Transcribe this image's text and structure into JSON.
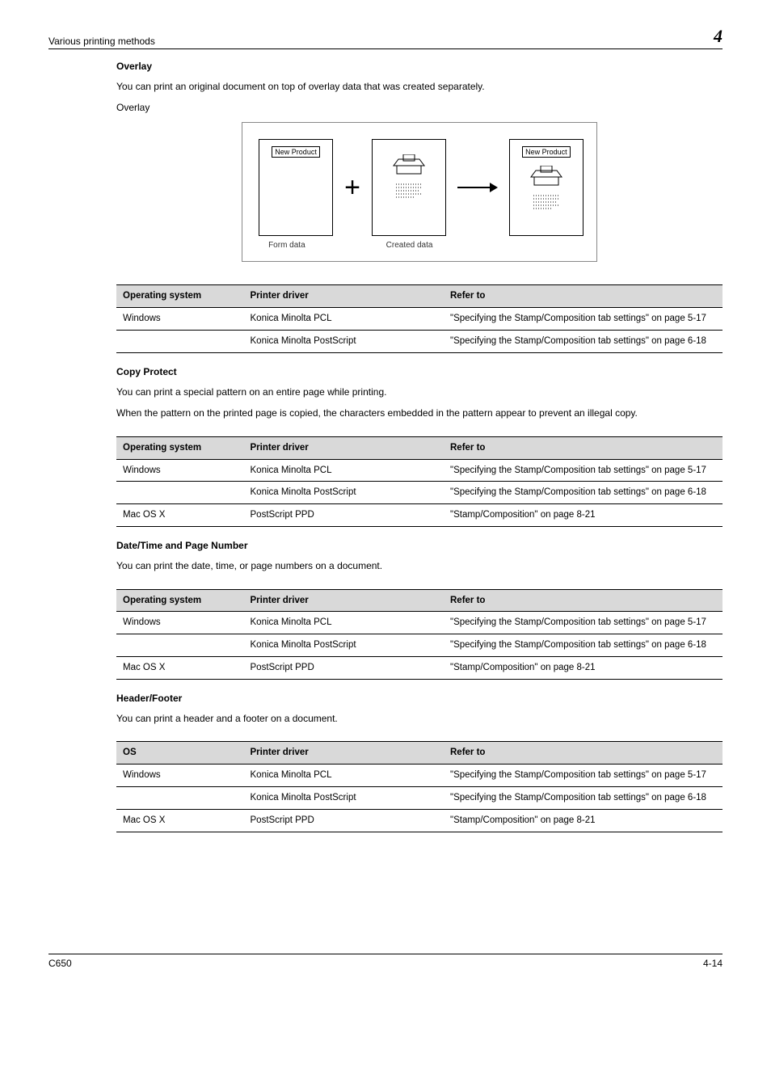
{
  "header": {
    "left": "Various printing methods",
    "right": "4"
  },
  "diagram": {
    "box1_label": "New Product",
    "box3_label": "New Product",
    "caption1": "Form data",
    "caption2": "Created data"
  },
  "sections": {
    "overlay": {
      "title": "Overlay",
      "desc": "You can print an original document on top of overlay data that was created separately.",
      "sub": "Overlay"
    },
    "copy_protect": {
      "title": "Copy Protect",
      "p1": "You can print a special pattern on an entire page while printing.",
      "p2": "When the pattern on the printed page is copied, the characters embedded in the pattern appear to prevent an illegal copy."
    },
    "date_time": {
      "title": "Date/Time and Page Number",
      "desc": "You can print the date, time, or page numbers on a document."
    },
    "header_footer": {
      "title": "Header/Footer",
      "desc": "You can print a header and a footer on a document."
    }
  },
  "table_headers": {
    "os": "Operating system",
    "os_alt": "OS",
    "drv": "Printer driver",
    "ref": "Refer to"
  },
  "tables": {
    "overlay": [
      {
        "os": "Windows",
        "drv": "Konica Minolta PCL",
        "ref": "\"Specifying the Stamp/Composition tab settings\" on page 5-17"
      },
      {
        "os": "",
        "drv": "Konica Minolta PostScript",
        "ref": "\"Specifying the Stamp/Composition tab settings\" on page 6-18"
      }
    ],
    "copy_protect": [
      {
        "os": "Windows",
        "drv": "Konica Minolta PCL",
        "ref": "\"Specifying the Stamp/Composition tab settings\" on page 5-17"
      },
      {
        "os": "",
        "drv": "Konica Minolta PostScript",
        "ref": "\"Specifying the Stamp/Composition tab settings\" on page 6-18"
      },
      {
        "os": "Mac OS X",
        "drv": "PostScript PPD",
        "ref": "\"Stamp/Composition\" on page 8-21"
      }
    ],
    "date_time": [
      {
        "os": "Windows",
        "drv": "Konica Minolta PCL",
        "ref": "\"Specifying the Stamp/Composition tab settings\" on page 5-17"
      },
      {
        "os": "",
        "drv": "Konica Minolta PostScript",
        "ref": "\"Specifying the Stamp/Composition tab settings\" on page 6-18"
      },
      {
        "os": "Mac OS X",
        "drv": "PostScript PPD",
        "ref": "\"Stamp/Composition\" on page 8-21"
      }
    ],
    "header_footer": [
      {
        "os": "Windows",
        "drv": "Konica Minolta PCL",
        "ref": "\"Specifying the Stamp/Composition tab settings\" on page 5-17"
      },
      {
        "os": "",
        "drv": "Konica Minolta PostScript",
        "ref": "\"Specifying the Stamp/Composition tab settings\" on page 6-18"
      },
      {
        "os": "Mac OS X",
        "drv": "PostScript PPD",
        "ref": "\"Stamp/Composition\" on page 8-21"
      }
    ]
  },
  "footer": {
    "left": "C650",
    "right": "4-14"
  }
}
